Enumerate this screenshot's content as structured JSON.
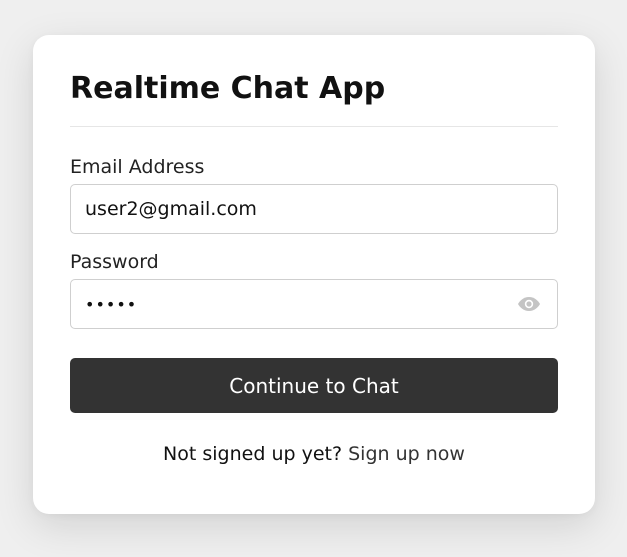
{
  "app": {
    "title": "Realtime Chat App"
  },
  "form": {
    "email_label": "Email Address",
    "email_value": "user2@gmail.com",
    "password_label": "Password",
    "password_value": "12345",
    "submit_label": "Continue to Chat"
  },
  "footer": {
    "prompt": "Not signed up yet?",
    "link_label": "Sign up now"
  },
  "icons": {
    "password_toggle": "eye-icon"
  },
  "colors": {
    "button_bg": "#333333",
    "page_bg": "#efefef"
  }
}
